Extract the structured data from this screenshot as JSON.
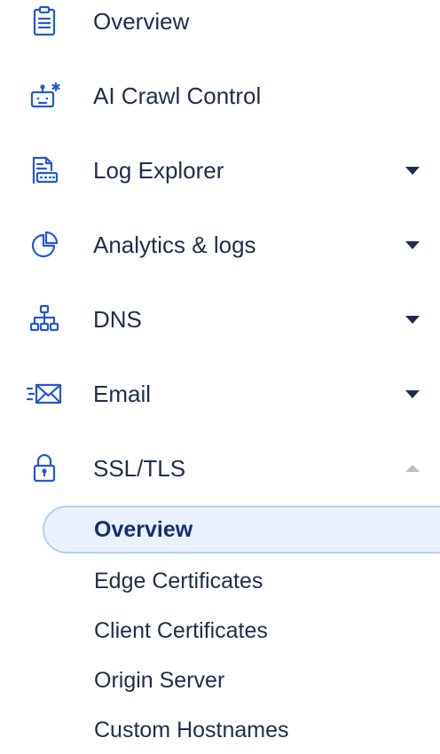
{
  "nav": {
    "items": [
      {
        "label": "Overview",
        "icon": "clipboard-icon",
        "expandable": false
      },
      {
        "label": "AI Crawl Control",
        "icon": "robot-icon",
        "expandable": false
      },
      {
        "label": "Log Explorer",
        "icon": "log-document-icon",
        "expandable": true,
        "expanded": false
      },
      {
        "label": "Analytics & logs",
        "icon": "pie-chart-icon",
        "expandable": true,
        "expanded": false
      },
      {
        "label": "DNS",
        "icon": "network-tree-icon",
        "expandable": true,
        "expanded": false
      },
      {
        "label": "Email",
        "icon": "envelope-icon",
        "expandable": true,
        "expanded": false
      },
      {
        "label": "SSL/TLS",
        "icon": "lock-icon",
        "expandable": true,
        "expanded": true
      }
    ],
    "ssl_submenu": [
      {
        "label": "Overview",
        "active": true
      },
      {
        "label": "Edge Certificates",
        "active": false
      },
      {
        "label": "Client Certificates",
        "active": false
      },
      {
        "label": "Origin Server",
        "active": false
      },
      {
        "label": "Custom Hostnames",
        "active": false
      }
    ]
  },
  "colors": {
    "icon": "#2457d6",
    "text": "#1f2d4d",
    "active_bg": "#eaf1fd",
    "active_border": "#b9cdf3",
    "caret": "#1f2d4d",
    "caret_expanded": "#b8bec9"
  }
}
